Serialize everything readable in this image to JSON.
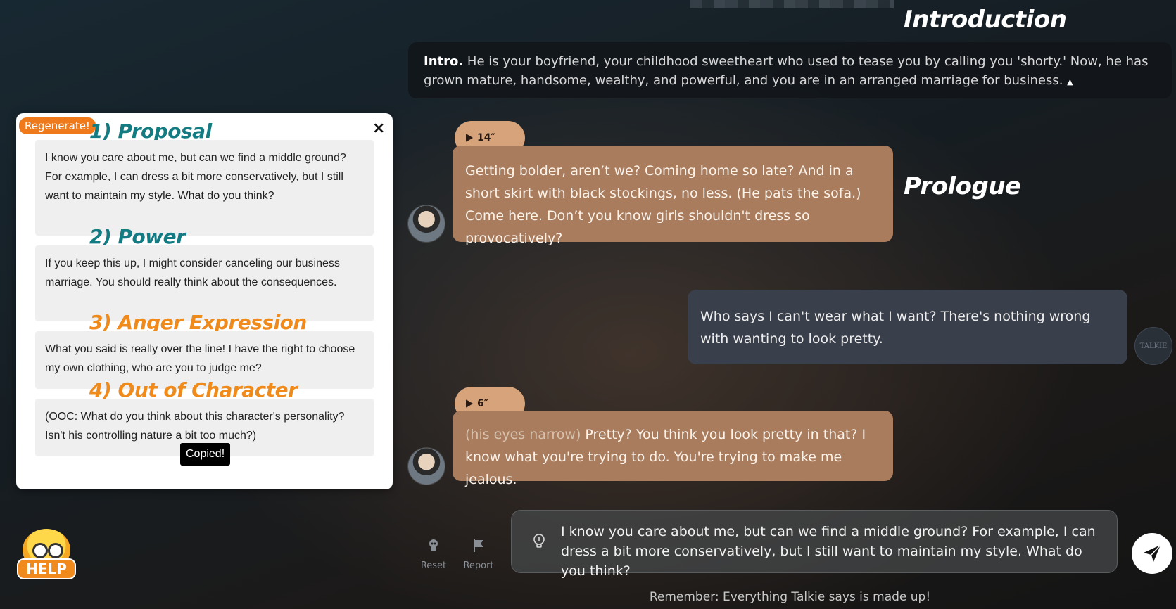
{
  "headers": {
    "introduction": "Introduction",
    "prologue": "Prologue"
  },
  "intro": {
    "label": "Intro.",
    "text": " He is your boyfriend, your childhood sweetheart who used to tease you by calling you 'shorty.' Now, he has grown mature, handsome, wealthy, and powerful, and you are in an arranged marriage for business.",
    "caret": "▲"
  },
  "messages": [
    {
      "role": "bot",
      "audio_duration": "14″",
      "text": "Getting bolder, aren’t we? Coming home so late? And in a short skirt with black stockings, no less. (He pats the sofa.) Come here. Don’t you know girls shouldn't dress so provocatively?"
    },
    {
      "role": "user",
      "text": "Who says I can't wear what I want? There's nothing wrong with wanting to look pretty."
    },
    {
      "role": "bot",
      "audio_duration": "6″",
      "action": "(his eyes narrow)",
      "text": " Pretty? You think you look pretty in that? I know what you're trying to do. You're trying to make me jealous."
    }
  ],
  "user_avatar_text": "TALKIE",
  "popup": {
    "regenerate_label": "Regenerate!",
    "close_label": "×",
    "copied_label": "Copied!",
    "sections": [
      {
        "title": "1) Proposal",
        "text": "I know you care about me, but can we find a middle ground? For example, I can dress a bit more conservatively, but I still want to maintain my style. What do you think?"
      },
      {
        "title": "2) Power",
        "text": "If you keep this up, I might consider canceling our business marriage. You should really think about the consequences."
      },
      {
        "title": "3) Anger Expression",
        "text": "What you said is really over the line! I have the right to choose my own clothing, who are you to judge me?"
      },
      {
        "title": "4) Out of Character",
        "text": "(OOC: What do you think about this character's personality? Isn't his controlling nature a bit too much?)"
      }
    ]
  },
  "help_label": "HELP",
  "toolbar": {
    "reset_label": "Reset",
    "report_label": "Report"
  },
  "input": {
    "value": "I know you care about me, but can we find a middle ground? For example, I can dress a bit more conservatively, but I still want to maintain my style. What do you think?"
  },
  "footer": "Remember: Everything Talkie says is made up!",
  "colors": {
    "bot_bubble": "#a97c5e",
    "user_bubble": "#3a3f4c",
    "accent_orange": "#ef8a1b",
    "accent_teal": "#137b82"
  }
}
